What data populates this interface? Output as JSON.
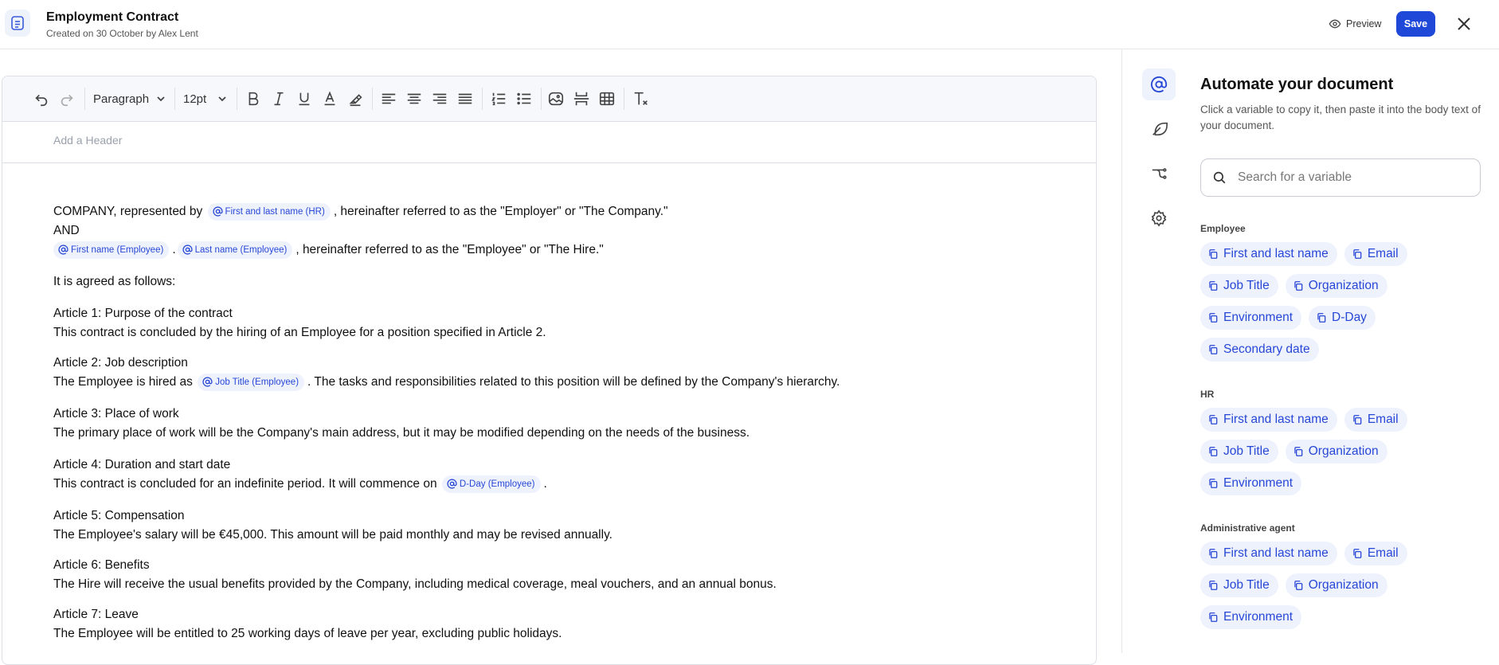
{
  "header": {
    "title": "Employment Contract",
    "subtitle": "Created on 30 October by Alex Lent",
    "preview_label": "Preview",
    "save_label": "Save"
  },
  "toolbar": {
    "block_style": "Paragraph",
    "font_size": "12pt"
  },
  "editor": {
    "header_placeholder": "Add a Header",
    "tags": {
      "hr_name": "First and last name (HR)",
      "emp_first": "First name (Employee)",
      "emp_last": "Last name (Employee)",
      "job_title": "Job Title (Employee)",
      "dday": "D-Day (Employee)"
    },
    "text": {
      "l1a": "COMPANY, represented by",
      "l1b": ", hereinafter referred to as the \"Employer\" or \"The Company.\"",
      "l2": "AND",
      "l3sep": ".",
      "l3b": ", hereinafter referred to as the \"Employee\" or \"The Hire.\"",
      "agreed": "It is agreed as follows:",
      "a1h": "Article 1: Purpose of the contract",
      "a1t": "This contract is concluded by the hiring of an Employee for a position specified in Article 2.",
      "a2h": "Article 2: Job description",
      "a2ta": "The Employee is hired as",
      "a2tb": ". The tasks and responsibilities related to this position will be defined by the Company's hierarchy.",
      "a3h": "Article 3: Place of work",
      "a3t": "The primary place of work will be the Company's main address, but it may be modified depending on the needs of the business.",
      "a4h": "Article 4: Duration and start date",
      "a4ta": "This contract is concluded for an indefinite period. It will commence on",
      "a4tb": ".",
      "a5h": "Article 5: Compensation",
      "a5t": "The Employee's salary will be €45,000. This amount will be paid monthly and may be revised annually.",
      "a6h": "Article 6: Benefits",
      "a6t": "The Hire will receive the usual benefits provided by the Company, including medical coverage, meal vouchers, and an annual bonus.",
      "a7h": "Article 7: Leave",
      "a7t": "The Employee will be entitled to 25 working days of leave per year, excluding public holidays."
    }
  },
  "panel": {
    "title": "Automate your document",
    "description": "Click a variable to copy it, then paste it into the body text of your document.",
    "search_placeholder": "Search for a variable",
    "groups": [
      {
        "label": "Employee",
        "variables": [
          "First and last name",
          "Email",
          "Job Title",
          "Organization",
          "Environment",
          "D-Day",
          "Secondary date"
        ]
      },
      {
        "label": "HR",
        "variables": [
          "First and last name",
          "Email",
          "Job Title",
          "Organization",
          "Environment"
        ]
      },
      {
        "label": "Administrative agent",
        "variables": [
          "First and last name",
          "Email",
          "Job Title",
          "Organization",
          "Environment"
        ]
      }
    ]
  },
  "colors": {
    "accent": "#1f48d9",
    "tag_bg": "#eef2fd",
    "tag_text": "#2747d6"
  }
}
